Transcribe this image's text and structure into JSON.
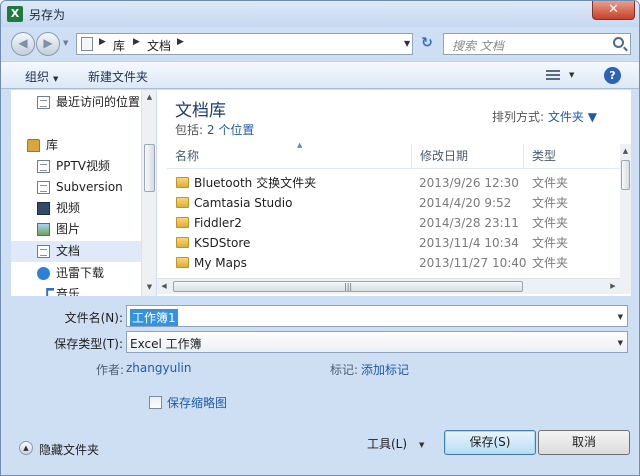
{
  "window": {
    "title": "另存为",
    "app_icon": "excel-icon",
    "close_label": "✕"
  },
  "address": {
    "crumbs": [
      "库",
      "文档"
    ],
    "search_placeholder": "搜索 文档"
  },
  "toolbar": {
    "organize": "组织",
    "new_folder": "新建文件夹"
  },
  "nav": {
    "items": [
      {
        "label": "最近访问的位置",
        "icon": "recent-places-icon"
      },
      {
        "label": "库",
        "icon": "library-icon"
      },
      {
        "label": "PPTV视频",
        "icon": "document-icon"
      },
      {
        "label": "Subversion",
        "icon": "document-icon"
      },
      {
        "label": "视频",
        "icon": "video-icon"
      },
      {
        "label": "图片",
        "icon": "picture-icon"
      },
      {
        "label": "文档",
        "icon": "document-icon",
        "selected": true
      },
      {
        "label": "迅雷下载",
        "icon": "thunder-icon"
      },
      {
        "label": "音乐",
        "icon": "music-icon"
      }
    ]
  },
  "library": {
    "title": "文档库",
    "includes_label": "包括:",
    "locations_link": "2 个位置",
    "arrange_label": "排列方式:",
    "arrange_value": "文件夹"
  },
  "columns": {
    "name": "名称",
    "date": "修改日期",
    "type": "类型"
  },
  "files": [
    {
      "name": "Bluetooth 交换文件夹",
      "date": "2013/9/26 12:30",
      "type": "文件夹"
    },
    {
      "name": "Camtasia Studio",
      "date": "2014/4/20 9:52",
      "type": "文件夹"
    },
    {
      "name": "Fiddler2",
      "date": "2014/3/28 23:11",
      "type": "文件夹"
    },
    {
      "name": "KSDStore",
      "date": "2013/11/4 10:34",
      "type": "文件夹"
    },
    {
      "name": "My Maps",
      "date": "2013/11/27 10:40",
      "type": "文件夹"
    }
  ],
  "form": {
    "filename_label": "文件名(N):",
    "filename_value": "工作簿1",
    "filetype_label": "保存类型(T):",
    "filetype_value": "Excel 工作簿",
    "author_label": "作者:",
    "author_value": "zhangyulin",
    "tags_label": "标记:",
    "tags_value": "添加标记",
    "thumbnail_label": "保存缩略图"
  },
  "footer": {
    "hide_folders": "隐藏文件夹",
    "tools": "工具(L)",
    "save": "保存(S)",
    "cancel": "取消"
  }
}
